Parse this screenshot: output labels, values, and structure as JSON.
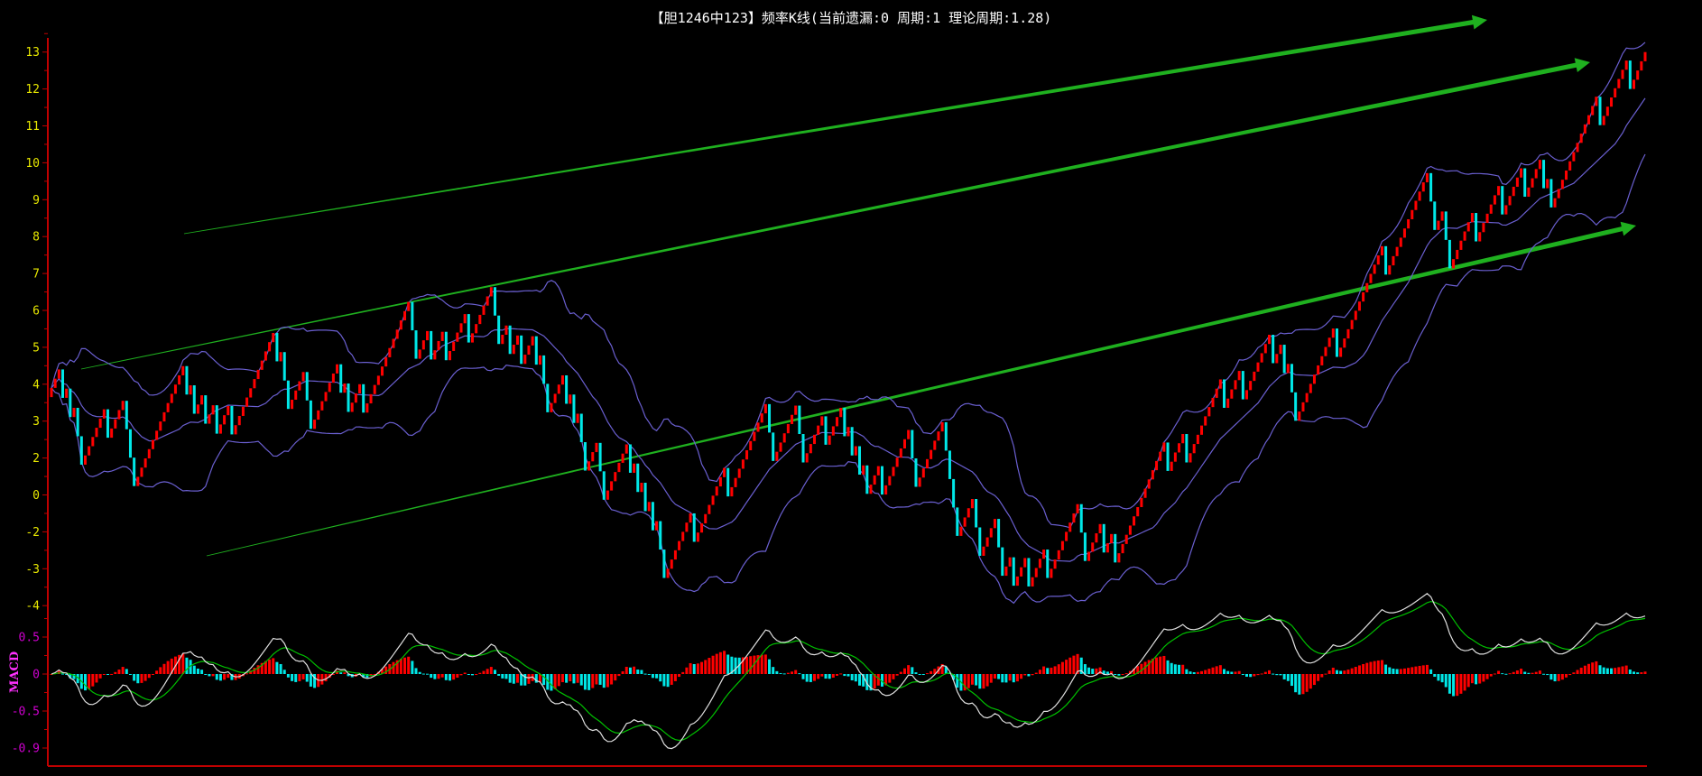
{
  "header": {
    "title": "【胆1246中123】频率K线(当前遗漏:0 周期:1 理论周期:1.28)"
  },
  "chart_data": {
    "type": "candlestick",
    "title": "【胆1246中123】频率K线(当前遗漏:0 周期:1 理论周期:1.28)",
    "up_step": 0.25,
    "down_step": 0.77,
    "start_value": 3.9,
    "bar_count": 425,
    "swings": [
      [
        0,
        3.9
      ],
      [
        1,
        4.2
      ],
      [
        8,
        2.0
      ],
      [
        14,
        3.45
      ],
      [
        15,
        1.9
      ],
      [
        20,
        2.95
      ],
      [
        22,
        1.45
      ],
      [
        36,
        4.05
      ],
      [
        38,
        2.75
      ],
      [
        41,
        3.35
      ],
      [
        44,
        2.25
      ],
      [
        46,
        2.8
      ],
      [
        48,
        2.15
      ],
      [
        60,
        5.1
      ],
      [
        63,
        3.25
      ],
      [
        68,
        4.05
      ],
      [
        69,
        3.3
      ],
      [
        75,
        5.0
      ],
      [
        79,
        3.35
      ],
      [
        82,
        3.95
      ],
      [
        83,
        3.2
      ],
      [
        95,
        6.4
      ],
      [
        97,
        4.9
      ],
      [
        100,
        5.5
      ],
      [
        101,
        4.75
      ],
      [
        104,
        5.4
      ],
      [
        105,
        4.65
      ],
      [
        110,
        5.9
      ],
      [
        111,
        5.15
      ],
      [
        117,
        6.75
      ],
      [
        119,
        4.43
      ],
      [
        122,
        5.07
      ],
      [
        125,
        4.07
      ],
      [
        129,
        4.8
      ],
      [
        132,
        2.75
      ],
      [
        135,
        3.57
      ],
      [
        142,
        1.37
      ],
      [
        145,
        2.0
      ],
      [
        147,
        -0.3
      ],
      [
        154,
        1.57
      ],
      [
        160,
        -0.3
      ],
      [
        161,
        0.1
      ],
      [
        163,
        -1.43
      ],
      [
        169,
        0.45
      ],
      [
        171,
        -0.27
      ],
      [
        179,
        1.62
      ],
      [
        180,
        0.84
      ],
      [
        190,
        3.4
      ],
      [
        192,
        2.1
      ],
      [
        197,
        3.33
      ],
      [
        200,
        2.0
      ],
      [
        205,
        3.48
      ],
      [
        206,
        2.75
      ],
      [
        208,
        3.15
      ],
      [
        217,
        0.67
      ],
      [
        220,
        1.45
      ],
      [
        221,
        0.67
      ],
      [
        227,
        2.1
      ],
      [
        230,
        0.85
      ],
      [
        233,
        1.65
      ],
      [
        238,
        1.89
      ],
      [
        241,
        -0.14
      ],
      [
        245,
        0.42
      ],
      [
        247,
        -0.82
      ],
      [
        250,
        -0.06
      ],
      [
        253,
        -1.3
      ],
      [
        255,
        -0.7
      ],
      [
        256,
        -1.5
      ],
      [
        259,
        -0.88
      ],
      [
        260,
        -1.6
      ],
      [
        264,
        -0.75
      ],
      [
        265,
        -1.5
      ],
      [
        273,
        0.78
      ],
      [
        275,
        -0.7
      ],
      [
        279,
        0.14
      ],
      [
        280,
        -0.63
      ],
      [
        282,
        -0.02
      ],
      [
        283,
        -0.75
      ],
      [
        296,
        2.6
      ],
      [
        297,
        1.87
      ],
      [
        301,
        2.9
      ],
      [
        302,
        2.18
      ],
      [
        311,
        4.46
      ],
      [
        312,
        3.72
      ],
      [
        316,
        4.8
      ],
      [
        317,
        4.0
      ],
      [
        324,
        5.68
      ],
      [
        325,
        4.95
      ],
      [
        327,
        5.36
      ],
      [
        328,
        4.63
      ],
      [
        329,
        4.8
      ],
      [
        331,
        3.48
      ],
      [
        341,
        6.02
      ],
      [
        342,
        5.24
      ],
      [
        350,
        7.4
      ],
      [
        351,
        6.66
      ],
      [
        354,
        7.24
      ],
      [
        355,
        6.6
      ],
      [
        367,
        8.47
      ],
      [
        368,
        7.68
      ],
      [
        371,
        8.3
      ],
      [
        372,
        7.57
      ],
      [
        378,
        9.03
      ],
      [
        379,
        8.3
      ],
      [
        385,
        9.52
      ],
      [
        386,
        8.78
      ],
      [
        391,
        10.05
      ],
      [
        392,
        9.32
      ],
      [
        396,
        10.13
      ],
      [
        397,
        9.4
      ],
      [
        398,
        9.77
      ],
      [
        399,
        9.03
      ],
      [
        411,
        12.0
      ],
      [
        412,
        11.23
      ],
      [
        419,
        12.94
      ],
      [
        420,
        12.16
      ],
      [
        424,
        13.43
      ]
    ],
    "y_range": [
      -2,
      13
    ],
    "y_ticks": [
      {
        "label": "13",
        "v": 13
      },
      {
        "label": "12",
        "v": 12
      },
      {
        "label": "11",
        "v": 11
      },
      {
        "label": "10",
        "v": 10
      },
      {
        "label": "9",
        "v": 9
      },
      {
        "label": "8",
        "v": 8
      },
      {
        "label": "7",
        "v": 7
      },
      {
        "label": "6",
        "v": 6
      },
      {
        "label": "5",
        "v": 5
      },
      {
        "label": "4",
        "v": 4
      },
      {
        "label": "3",
        "v": 3
      },
      {
        "label": "2",
        "v": 2
      },
      {
        "label": "0",
        "v": 1
      },
      {
        "label": "-2",
        "v": 0
      },
      {
        "label": "-3",
        "v": -1
      },
      {
        "label": "-4",
        "v": -2
      }
    ],
    "bollinger": {
      "period": 20,
      "k": 2
    },
    "macd": {
      "label": "MACD",
      "fast": 12,
      "slow": 26,
      "signal": 9,
      "y_ticks": [
        {
          "label": "0.5",
          "v": 0.5
        },
        {
          "label": "0",
          "v": 0
        },
        {
          "label": "-0.5",
          "v": -0.5
        },
        {
          "label": "-0.9",
          "v": -1.0
        }
      ]
    },
    "trend_arrows": 3,
    "colors": {
      "up": "#ff0000",
      "down": "#00e8e8",
      "band": "#6a5fd0",
      "dif": "#e0e0e0",
      "dea": "#00c000",
      "arrow": "#1fb01f",
      "axis": "#c00000",
      "price_tick": "#e8e800",
      "macd_tick": "#d000d0"
    }
  }
}
